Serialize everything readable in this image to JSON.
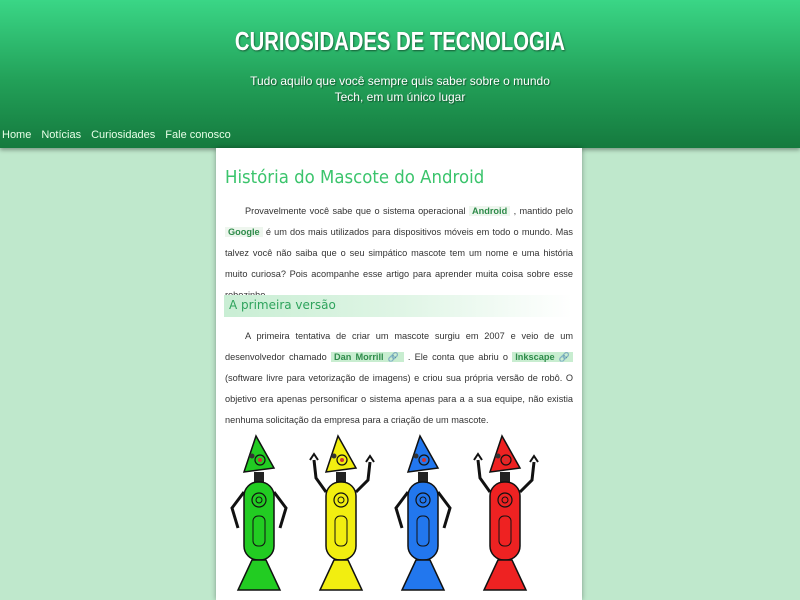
{
  "site": {
    "title": "CURIOSIDADES DE TECNOLOGIA",
    "tagline_line1": "Tudo aquilo que você sempre quis saber sobre o mundo",
    "tagline_line2": "Tech, em um único lugar"
  },
  "nav": {
    "items": [
      "Home",
      "Notícias",
      "Curiosidades",
      "Fale conosco"
    ]
  },
  "article": {
    "title": "História do Mascote do Android",
    "p1": {
      "t1": "Provavelmente você sabe que o sistema operacional ",
      "kw1": "Android",
      "t2": " , mantido pelo ",
      "kw2": "Google",
      "t3": " é um dos mais utilizados para dispositivos móveis em todo o mundo. Mas talvez você não saiba que o seu simpático mascote tem um nome e uma história muito curiosa? Pois acompanhe esse artigo para aprender muita coisa sobre esse robozinho."
    },
    "section_title": "A primeira versão",
    "p2": {
      "t1": "A primeira tentativa de criar um mascote surgiu em 2007 e veio de um desenvolvedor chamado ",
      "kw1": "Dan Morrill",
      "t2": " . Ele conta que abriu o ",
      "kw2": "Inkscape",
      "t3": " (software livre para vetorização de imagens) e criou sua própria versão de robô. O objetivo era apenas personificar o sistema apenas para a a sua equipe, não existia nenhuma solicitação da empresa para a criação de um mascote."
    },
    "link_icon": "🔗",
    "mascot_colors": [
      "#22cc22",
      "#f2ee10",
      "#2277ee",
      "#ee2222"
    ]
  },
  "colors": {
    "header_top": "#3ad686",
    "header_bottom": "#157a3e",
    "background": "#bfe8cc",
    "accent": "#3bc46c"
  }
}
